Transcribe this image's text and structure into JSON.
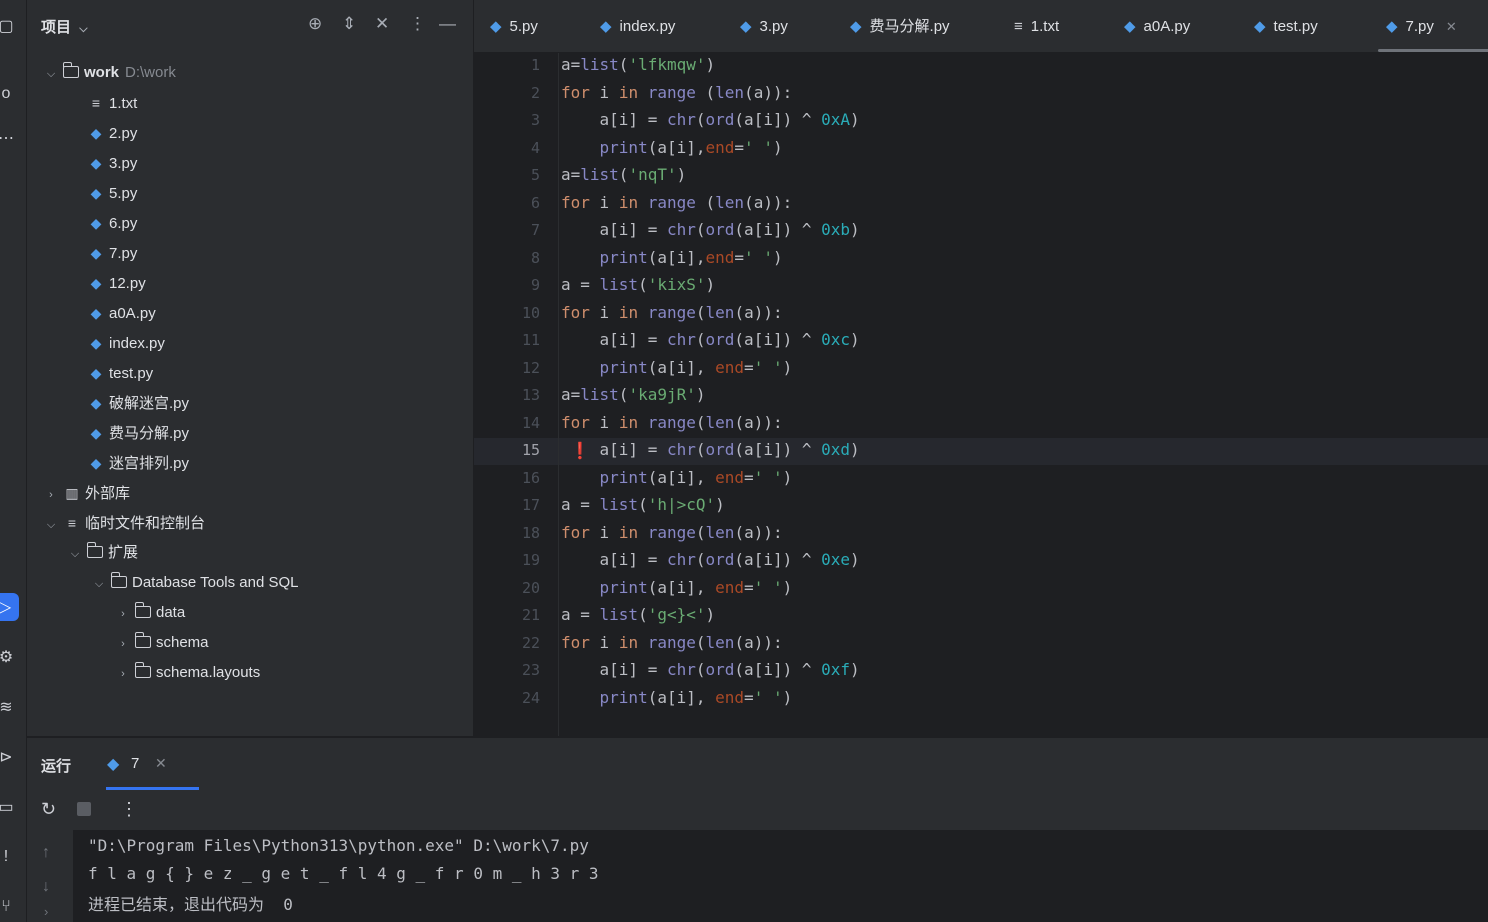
{
  "project": {
    "title": "项目",
    "tree": [
      {
        "label": "work",
        "sub": "D:\\work",
        "kind": "folder",
        "depth": 0,
        "chev": "down"
      },
      {
        "label": "1.txt",
        "kind": "txt",
        "depth": 1
      },
      {
        "label": "2.py",
        "kind": "py",
        "depth": 1
      },
      {
        "label": "3.py",
        "kind": "py",
        "depth": 1
      },
      {
        "label": "5.py",
        "kind": "py",
        "depth": 1
      },
      {
        "label": "6.py",
        "kind": "py",
        "depth": 1
      },
      {
        "label": "7.py",
        "kind": "py",
        "depth": 1
      },
      {
        "label": "12.py",
        "kind": "py",
        "depth": 1
      },
      {
        "label": "a0A.py",
        "kind": "py",
        "depth": 1
      },
      {
        "label": "index.py",
        "kind": "py",
        "depth": 1
      },
      {
        "label": "test.py",
        "kind": "py",
        "depth": 1
      },
      {
        "label": "破解迷宫.py",
        "kind": "py",
        "depth": 1
      },
      {
        "label": "费马分解.py",
        "kind": "py",
        "depth": 1
      },
      {
        "label": "迷宫排列.py",
        "kind": "py",
        "depth": 1
      },
      {
        "label": "外部库",
        "kind": "lib",
        "depth": 0,
        "chev": "right"
      },
      {
        "label": "临时文件和控制台",
        "kind": "scratch",
        "depth": 0,
        "chev": "down"
      },
      {
        "label": "扩展",
        "kind": "folder",
        "depth": 1,
        "chev": "down"
      },
      {
        "label": "Database Tools and SQL",
        "kind": "folder",
        "depth": 2,
        "chev": "down"
      },
      {
        "label": "data",
        "kind": "folder",
        "depth": 3,
        "chev": "right"
      },
      {
        "label": "schema",
        "kind": "folder",
        "depth": 3,
        "chev": "right"
      },
      {
        "label": "schema.layouts",
        "kind": "folder",
        "depth": 3,
        "chev": "right"
      }
    ]
  },
  "tabs": [
    {
      "label": "5.py",
      "kind": "py"
    },
    {
      "label": "index.py",
      "kind": "py"
    },
    {
      "label": "3.py",
      "kind": "py"
    },
    {
      "label": "费马分解.py",
      "kind": "py"
    },
    {
      "label": "1.txt",
      "kind": "txt"
    },
    {
      "label": "a0A.py",
      "kind": "py"
    },
    {
      "label": "test.py",
      "kind": "py"
    },
    {
      "label": "7.py",
      "kind": "py",
      "active": true
    }
  ],
  "editor": {
    "current_line": 15,
    "lines": [
      "a=list('lfkmqw')",
      "for i in range (len(a)):",
      "    a[i] = chr(ord(a[i]) ^ 0xA)",
      "    print(a[i],end=' ')",
      "a=list('nqT')",
      "for i in range (len(a)):",
      "    a[i] = chr(ord(a[i]) ^ 0xb)",
      "    print(a[i],end=' ')",
      "a = list('kixS')",
      "for i in range(len(a)):",
      "    a[i] = chr(ord(a[i]) ^ 0xc)",
      "    print(a[i], end=' ')",
      "a=list('ka9jR')",
      "for i in range(len(a)):",
      "    a[i] = chr(ord(a[i]) ^ 0xd)",
      "    print(a[i], end=' ')",
      "a = list('h|>cQ')",
      "for i in range(len(a)):",
      "    a[i] = chr(ord(a[i]) ^ 0xe)",
      "    print(a[i], end=' ')",
      "a = list('g<}<')",
      "for i in range(len(a)):",
      "    a[i] = chr(ord(a[i]) ^ 0xf)",
      "    print(a[i], end=' ')"
    ]
  },
  "run": {
    "title": "运行",
    "tab_label": "7",
    "console": [
      "\"D:\\Program Files\\Python313\\python.exe\" D:\\work\\7.py",
      "f l a g { } e z _ g e t _ f l 4 g _ f r 0 m _ h 3 r 3",
      "进程已结束，退出代码为  0"
    ]
  }
}
